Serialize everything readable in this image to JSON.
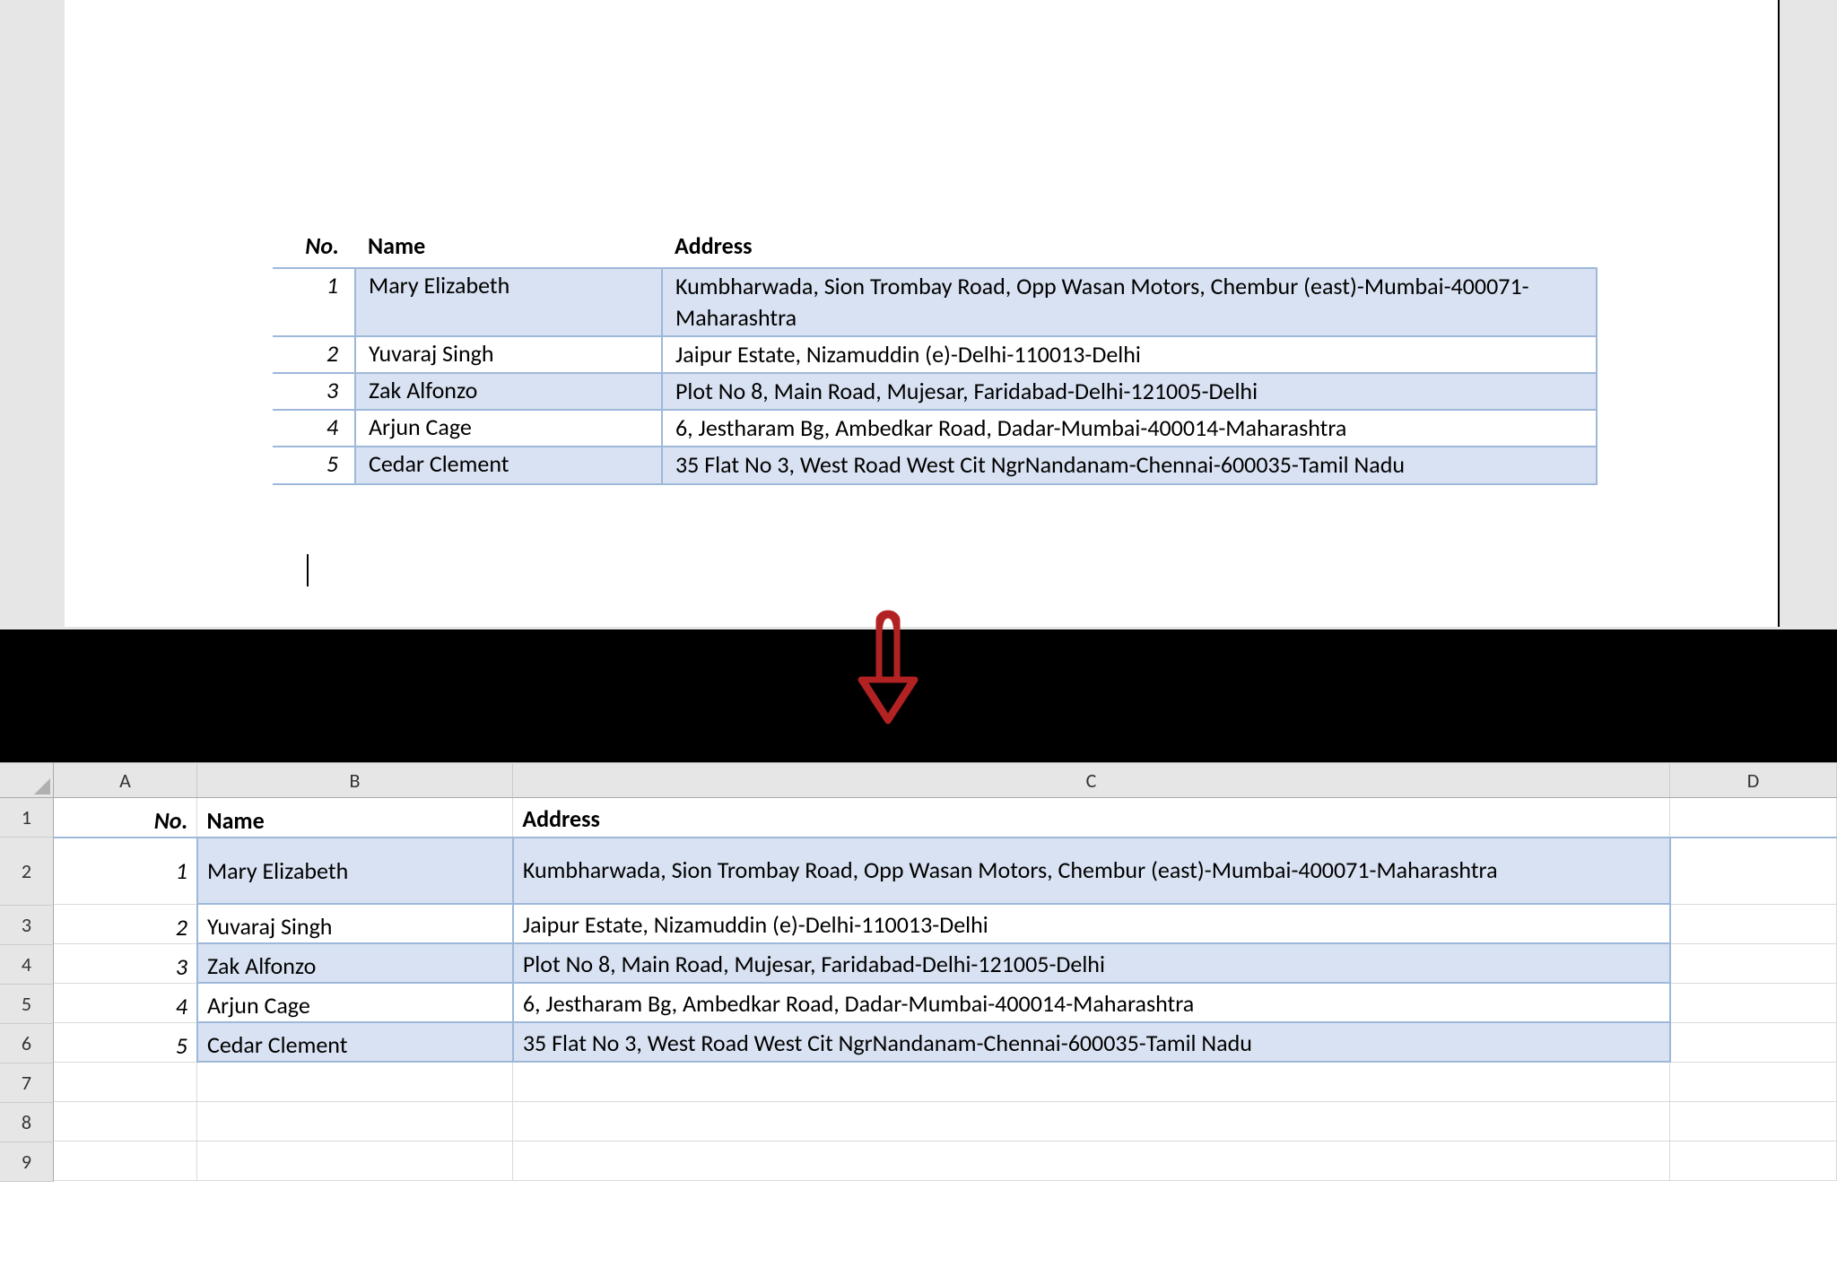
{
  "doc_table": {
    "headers": {
      "no": "No.",
      "name": "Name",
      "addr": "Address"
    },
    "rows": [
      {
        "no": "1",
        "name": "Mary Elizabeth",
        "addr": "Kumbharwada, Sion Trombay Road, Opp Wasan Motors, Chembur (east)-Mumbai-400071-Maharashtra"
      },
      {
        "no": "2",
        "name": "Yuvaraj Singh",
        "addr": "Jaipur Estate, Nizamuddin (e)-Delhi-110013-Delhi"
      },
      {
        "no": "3",
        "name": "Zak Alfonzo",
        "addr": "Plot No 8, Main Road, Mujesar, Faridabad-Delhi-121005-Delhi"
      },
      {
        "no": "4",
        "name": "Arjun Cage",
        "addr": "6, Jestharam Bg, Ambedkar Road, Dadar-Mumbai-400014-Maharashtra"
      },
      {
        "no": "5",
        "name": "Cedar Clement",
        "addr": "35 Flat No 3, West Road West Cit NgrNandanam-Chennai-600035-Tamil Nadu"
      }
    ]
  },
  "excel": {
    "col_labels": {
      "A": "A",
      "B": "B",
      "C": "C",
      "D": "D"
    },
    "row_labels": [
      "1",
      "2",
      "3",
      "4",
      "5",
      "6",
      "7",
      "8",
      "9"
    ],
    "headers": {
      "no": "No.",
      "name": "Name",
      "addr": "Address"
    },
    "rows": [
      {
        "no": "1",
        "name": "Mary Elizabeth",
        "addr": "Kumbharwada, Sion Trombay Road, Opp Wasan Motors, Chembur (east)-Mumbai-400071-Maharashtra"
      },
      {
        "no": "2",
        "name": "Yuvaraj Singh",
        "addr": "Jaipur Estate, Nizamuddin (e)-Delhi-110013-Delhi"
      },
      {
        "no": "3",
        "name": "Zak Alfonzo",
        "addr": "Plot No 8, Main Road, Mujesar, Faridabad-Delhi-121005-Delhi"
      },
      {
        "no": "4",
        "name": "Arjun Cage",
        "addr": "6, Jestharam Bg, Ambedkar Road, Dadar-Mumbai-400014-Maharashtra"
      },
      {
        "no": "5",
        "name": "Cedar Clement",
        "addr": "35 Flat No 3, West Road West Cit NgrNandanam-Chennai-600035-Tamil Nadu"
      }
    ]
  },
  "colors": {
    "table_border": "#9db8d9",
    "band_fill": "#d9e2f2",
    "arrow": "#b22222"
  }
}
